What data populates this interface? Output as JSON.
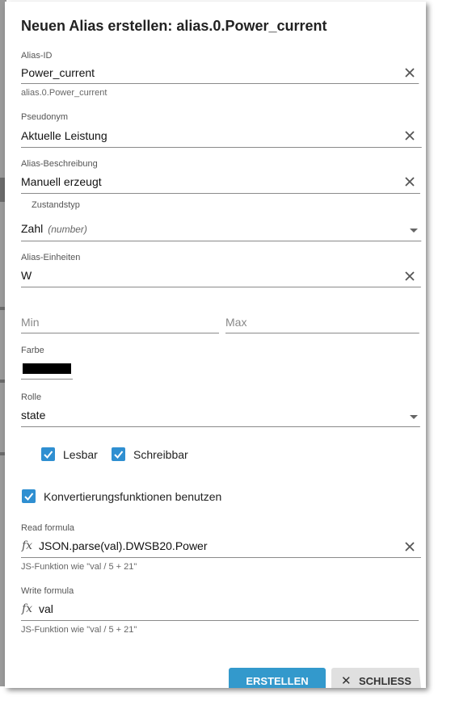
{
  "dialog": {
    "title": "Neuen Alias erstellen: alias.0.Power_current"
  },
  "alias_id": {
    "label": "Alias-ID",
    "value": "Power_current",
    "helper": "alias.0.Power_current"
  },
  "pseudonym": {
    "label": "Pseudonym",
    "value": "Aktuelle Leistung"
  },
  "description": {
    "label": "Alias-Beschreibung",
    "value": "Manuell erzeugt"
  },
  "state_type": {
    "label": "Zustandstyp",
    "value": "Zahl",
    "hint": "(number)"
  },
  "units": {
    "label": "Alias-Einheiten",
    "value": "W"
  },
  "min": {
    "placeholder": "Min"
  },
  "max": {
    "placeholder": "Max"
  },
  "color": {
    "label": "Farbe",
    "value": "#000000"
  },
  "role": {
    "label": "Rolle",
    "value": "state"
  },
  "checkboxes": {
    "readable": "Lesbar",
    "writable": "Schreibbar",
    "use_conversion": "Konvertierungsfunktionen benutzen"
  },
  "read_formula": {
    "label": "Read formula",
    "value": "JSON.parse(val).DWSB20.Power",
    "helper": "JS-Funktion wie \"val / 5 + 21\""
  },
  "write_formula": {
    "label": "Write formula",
    "value": "val",
    "helper": "JS-Funktion wie \"val / 5 + 21\""
  },
  "buttons": {
    "create": "ERSTELLEN",
    "close": "SCHLIESS"
  },
  "colors": {
    "primary": "#3399cc",
    "checkbox": "#2f8fd1"
  }
}
